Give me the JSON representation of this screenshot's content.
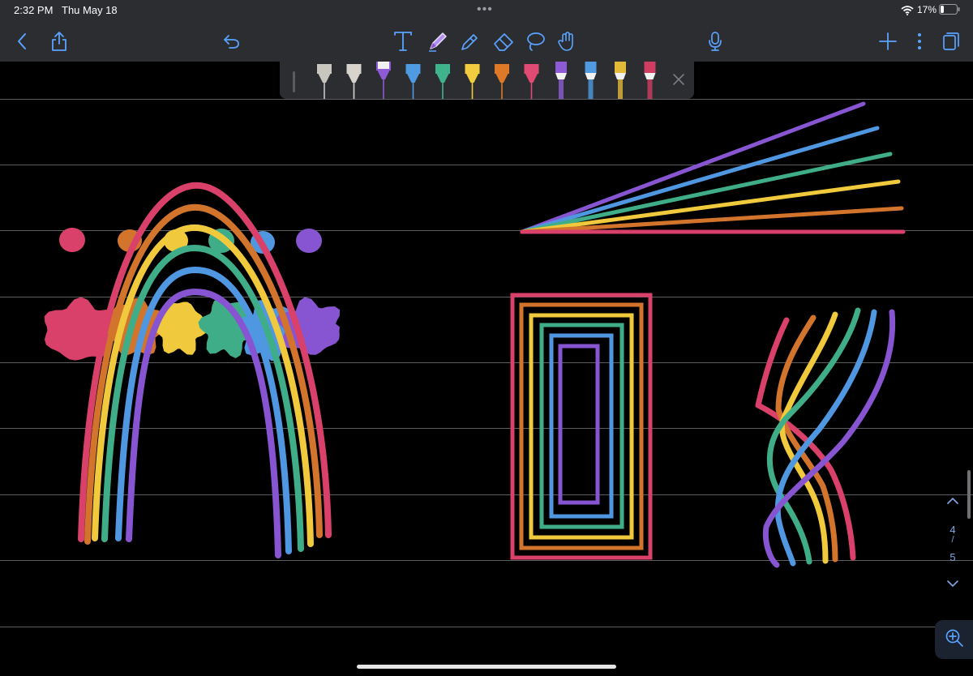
{
  "status": {
    "time": "2:32 PM",
    "date": "Thu May 18",
    "battery": "17%",
    "dots": "•••"
  },
  "toolbar": {
    "left": [
      "back-icon",
      "share-icon",
      "undo-icon"
    ],
    "center": [
      "text-tool-icon",
      "pen-tool-icon",
      "highlighter-tool-icon",
      "eraser-tool-icon",
      "lasso-tool-icon",
      "hand-tool-icon"
    ],
    "right": [
      "microphone-icon",
      "add-page-icon",
      "more-icon",
      "pages-icon"
    ],
    "active_tool": "pen-tool-icon"
  },
  "pen_tray": {
    "pens": [
      {
        "name": "pen-gray",
        "color": "#c9c6c0"
      },
      {
        "name": "pen-silver",
        "color": "#d8d4cd"
      },
      {
        "name": "pen-purple",
        "color": "#8e5ad6",
        "selected": true
      },
      {
        "name": "pen-blue",
        "color": "#4f9ae0"
      },
      {
        "name": "pen-green",
        "color": "#3fb38b"
      },
      {
        "name": "pen-yellow",
        "color": "#f2cc3f"
      },
      {
        "name": "pen-orange",
        "color": "#de7a27"
      },
      {
        "name": "pen-pink",
        "color": "#e04a73"
      },
      {
        "name": "highlighter-purple",
        "color": "#8e5ad6"
      },
      {
        "name": "highlighter-blue",
        "color": "#4f9ae0"
      },
      {
        "name": "highlighter-yellow",
        "color": "#e3b93a"
      },
      {
        "name": "highlighter-pink",
        "color": "#cf3d63"
      }
    ]
  },
  "palette": {
    "pink": "#d9416b",
    "orange": "#d2742b",
    "yellow": "#f0c93c",
    "green": "#3fae88",
    "blue": "#4f97e0",
    "purple": "#8755d1",
    "toolbar_bg": "#2b2d31",
    "accent": "#5aa3ff",
    "rule_line": "#5c5e62"
  },
  "page_nav": {
    "current": "4",
    "separator": "/",
    "total": "5"
  }
}
